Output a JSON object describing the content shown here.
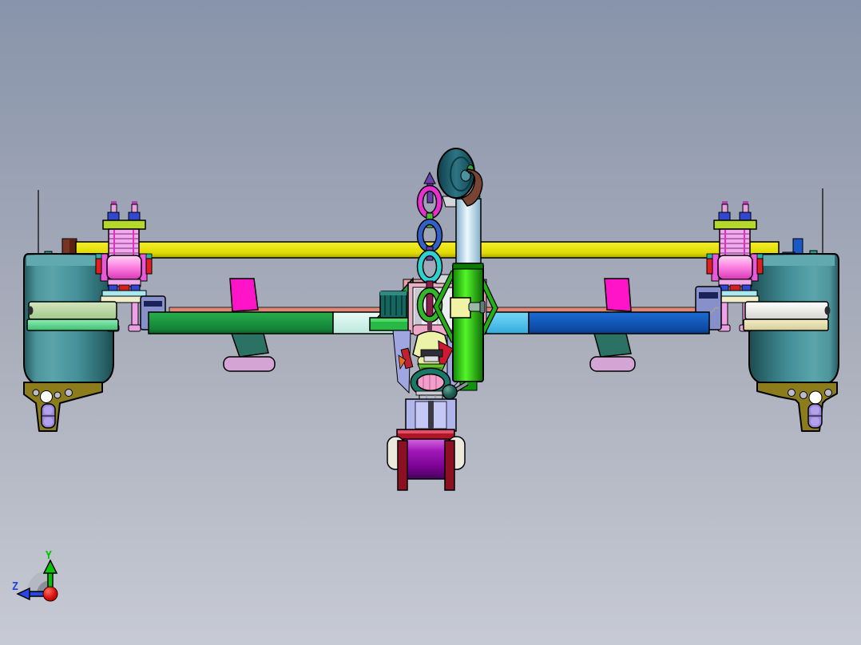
{
  "viewport": {
    "app": "CAD 3D viewport",
    "view": "Front shaded view of a symmetric implement assembly with two ground wheels, a central crank, chain and press roller",
    "background_top": "#8894ab",
    "background_bottom": "#c7cad4"
  },
  "axis_triad": {
    "y_label": "Y",
    "z_label": "Z",
    "y_axis_color": "#00c400",
    "z_axis_color": "#2946e0",
    "origin_color": "#e01010"
  },
  "palette": {
    "frame_yellow": "#e8e312",
    "top_face_salmon": "#e08878",
    "wheel_teal": "#45939a",
    "bracket_olive": "#8c7c1c",
    "pill_purple": "#9988d8",
    "flap_magenta": "#ff14c8",
    "under_tab_teal": "#2c7264",
    "foot_lavender": "#d4a4d4",
    "bar_sage": "#b9d8a0",
    "bar_mint": "#74e29c",
    "bar_green": "#1da442",
    "bar_pale_cyan": "#dcf6ee",
    "bar_sky": "#55c8f0",
    "bar_dark_blue": "#1257b8",
    "bar_white": "#f4f4f2",
    "bar_cream": "#ece6b4",
    "ladder_pink": "#f2aaee",
    "clamp_red": "#e02020",
    "block_blue": "#3048d0",
    "cap_lime": "#b4d82c",
    "plate_cyan": "#a8e8f0",
    "strip_cream": "#f0eec8",
    "panel_lavender": "#8890cc",
    "panel_navy": "#1a2258",
    "crank_brown": "#7a4434",
    "chain_magenta": "#e830d0",
    "chain_blue": "#3060c8",
    "chain_cyan": "#2ed0d0",
    "chain_green": "#48c030",
    "chain_purple": "#6a40a8",
    "rod_maroon": "#8a2048",
    "box_frame": "#f0f0f4",
    "box_border": "#e8b0c4",
    "hopper_green": "#22a03c",
    "motor_teal": "#14665e",
    "bell_cream": "#ecf2a8",
    "collar_pink": "#f0a8c8",
    "wedge_red": "#d01830",
    "funnel_green": "#66c22c",
    "ring_teal": "#1a7868",
    "inner_pink": "#f0a0c8",
    "nut_gray": "#b8bcc8",
    "housing_periwinkle": "#b0b6ec",
    "fork_crimson": "#b01628",
    "cap_ivory": "#ece8dc",
    "post_maroon": "#7a3424",
    "post_blue": "#1858c8",
    "stub_teal": "#20a090",
    "ball_teal": "#1d6055",
    "block_yellow": "#f2f2a6"
  }
}
